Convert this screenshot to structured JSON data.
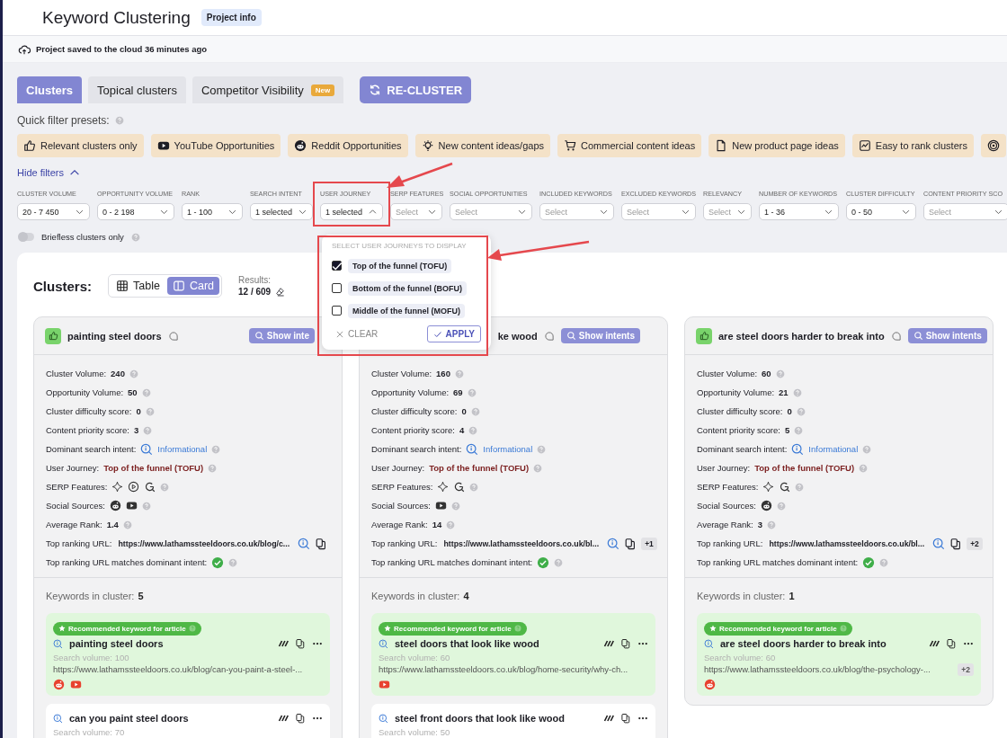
{
  "header": {
    "title": "Keyword Clustering",
    "badge": "Project info"
  },
  "save_status": "Project saved to the cloud 36 minutes ago",
  "tabs": [
    {
      "label": "Clusters",
      "selected": true
    },
    {
      "label": "Topical clusters",
      "selected": false
    },
    {
      "label": "Competitor Visibility",
      "selected": false,
      "badge": "New"
    }
  ],
  "recluster_button": "RE-CLUSTER",
  "presets": {
    "label": "Quick filter presets:",
    "items": [
      {
        "kind": "thumb",
        "label": "Relevant clusters only"
      },
      {
        "kind": "youtube",
        "label": "YouTube Opportunities"
      },
      {
        "kind": "reddit",
        "label": "Reddit Opportunities"
      },
      {
        "kind": "bulb",
        "label": "New content ideas/gaps"
      },
      {
        "kind": "cart",
        "label": "Commercial content ideas"
      },
      {
        "kind": "doc",
        "label": "New product page ideas"
      },
      {
        "kind": "chart",
        "label": "Easy to rank clusters"
      },
      {
        "kind": "target"
      }
    ]
  },
  "hide_filters": {
    "label": "Hide filters",
    "expanded": true
  },
  "filters": [
    {
      "label": "CLUSTER VOLUME",
      "value": "20 - 7 450"
    },
    {
      "label": "OPPORTUNITY VOLUME",
      "value": "0 - 2 198"
    },
    {
      "label": "RANK",
      "value": "1 - 100"
    },
    {
      "label": "SEARCH INTENT",
      "value": "1 selected"
    },
    {
      "label": "USER JOURNEY",
      "value": "1 selected",
      "expanded": true,
      "highlighted": true,
      "dropdown": {
        "heading": "SELECT USER JOURNEYS TO DISPLAY",
        "options": [
          {
            "label": "Top of the funnel (TOFU)",
            "checked": true
          },
          {
            "label": "Bottom of the funnel (BOFU)",
            "checked": false
          },
          {
            "label": "Middle of the funnel (MOFU)",
            "checked": false
          }
        ],
        "clear": "CLEAR",
        "apply": "APPLY"
      }
    },
    {
      "label": "SERP FEATURES",
      "placeholder": "Select"
    },
    {
      "label": "SOCIAL OPPORTUNITIES",
      "placeholder": "Select"
    },
    {
      "label": "INCLUDED KEYWORDS",
      "placeholder": "Select"
    },
    {
      "label": "EXCLUDED KEYWORDS",
      "placeholder": "Select"
    },
    {
      "label": "RELEVANCY",
      "placeholder": "Select"
    },
    {
      "label": "NUMBER OF KEYWORDS",
      "value": "1 - 36"
    },
    {
      "label": "CLUSTER DIFFICULTY",
      "value": "0 - 50"
    },
    {
      "label": "CONTENT PRIORITY SCO",
      "placeholder": "Select"
    }
  ],
  "briefless_toggle": {
    "label": "Briefless clusters only",
    "on": false
  },
  "clusters": {
    "title": "Clusters:",
    "views": [
      {
        "kind": "table",
        "label": "Table",
        "selected": false
      },
      {
        "kind": "card",
        "label": "Card",
        "selected": true
      }
    ],
    "results_label": "Results:",
    "results_value": "12 / 609",
    "cards": [
      {
        "thumb": true,
        "title": "painting steel doors",
        "intents_button": "Show inte",
        "stats": [
          {
            "kind": "value",
            "label": "Cluster Volume:",
            "value": "240"
          },
          {
            "kind": "value",
            "label": "Opportunity Volume:",
            "value": "50"
          },
          {
            "kind": "value",
            "label": "Cluster difficulty score:",
            "value": "0"
          },
          {
            "kind": "value",
            "label": "Content priority score:",
            "value": "3"
          },
          {
            "kind": "intent",
            "label": "Dominant search intent:",
            "value": "Informational"
          },
          {
            "kind": "journey",
            "label": "User Journey:",
            "value": "Top of the funnel (TOFU)"
          },
          {
            "kind": "icons",
            "label": "SERP Features:",
            "icons": [
              {
                "kind": "sparkle"
              },
              {
                "kind": "play"
              },
              {
                "kind": "google"
              }
            ]
          },
          {
            "kind": "icons",
            "label": "Social Sources:",
            "icons": [
              {
                "kind": "reddit"
              },
              {
                "kind": "youtube"
              }
            ]
          },
          {
            "kind": "value",
            "label": "Average Rank:",
            "value": "1.4"
          },
          {
            "kind": "url",
            "label": "Top ranking URL:",
            "value": "https://www.lathamssteeldoors.co.uk/blog/c..."
          },
          {
            "kind": "match",
            "label": "Top ranking URL matches dominant intent:",
            "ok": true
          }
        ],
        "keywords_label": "Keywords in cluster:",
        "keywords_count": "5",
        "keywords": [
          {
            "recommended": true,
            "badge": "Recommended keyword for article",
            "title": "painting steel doors",
            "volume": "Search volume: 100",
            "url": "https://www.lathamssteeldoors.co.uk/blog/can-you-paint-a-steel-...",
            "icons": [
              {
                "kind": "reddit"
              },
              {
                "kind": "youtube"
              }
            ]
          },
          {
            "recommended": false,
            "title": "can you paint steel doors",
            "volume": "Search volume: 70"
          }
        ]
      },
      {
        "thumb": false,
        "title": "ke wood",
        "intents_button": "Show intents",
        "stats": [
          {
            "kind": "value",
            "label": "Cluster Volume:",
            "value": "160"
          },
          {
            "kind": "value",
            "label": "Opportunity Volume:",
            "value": "69"
          },
          {
            "kind": "value",
            "label": "Cluster difficulty score:",
            "value": "0"
          },
          {
            "kind": "value",
            "label": "Content priority score:",
            "value": "4"
          },
          {
            "kind": "intent",
            "label": "Dominant search intent:",
            "value": "Informational"
          },
          {
            "kind": "journey",
            "label": "User Journey:",
            "value": "Top of the funnel (TOFU)"
          },
          {
            "kind": "icons",
            "label": "SERP Features:",
            "icons": [
              {
                "kind": "sparkle"
              },
              {
                "kind": "google"
              }
            ]
          },
          {
            "kind": "icons",
            "label": "Social Sources:",
            "icons": [
              {
                "kind": "youtube"
              }
            ]
          },
          {
            "kind": "value",
            "label": "Average Rank:",
            "value": "14"
          },
          {
            "kind": "url",
            "label": "Top ranking URL:",
            "value": "https://www.lathamssteeldoors.co.uk/bl...",
            "extra": "+1"
          },
          {
            "kind": "match",
            "label": "Top ranking URL matches dominant intent:",
            "ok": true
          }
        ],
        "keywords_label": "Keywords in cluster:",
        "keywords_count": "4",
        "keywords": [
          {
            "recommended": true,
            "badge": "Recommended keyword for article",
            "title": "steel doors that look like wood",
            "volume": "Search volume: 60",
            "url": "https://www.lathamssteeldoors.co.uk/blog/home-security/why-ch...",
            "icons": [
              {
                "kind": "youtube"
              }
            ]
          },
          {
            "recommended": false,
            "title": "steel front doors that look like wood",
            "volume": "Search volume: 50"
          }
        ]
      },
      {
        "thumb": true,
        "title": "are steel doors harder to break into",
        "intents_button": "Show intents",
        "stats": [
          {
            "kind": "value",
            "label": "Cluster Volume:",
            "value": "60"
          },
          {
            "kind": "value",
            "label": "Opportunity Volume:",
            "value": "21"
          },
          {
            "kind": "value",
            "label": "Cluster difficulty score:",
            "value": "0"
          },
          {
            "kind": "value",
            "label": "Content priority score:",
            "value": "5"
          },
          {
            "kind": "intent",
            "label": "Dominant search intent:",
            "value": "Informational"
          },
          {
            "kind": "journey",
            "label": "User Journey:",
            "value": "Top of the funnel (TOFU)"
          },
          {
            "kind": "icons",
            "label": "SERP Features:",
            "icons": [
              {
                "kind": "sparkle"
              },
              {
                "kind": "google"
              }
            ]
          },
          {
            "kind": "icons",
            "label": "Social Sources:",
            "icons": [
              {
                "kind": "reddit"
              }
            ]
          },
          {
            "kind": "value",
            "label": "Average Rank:",
            "value": "3"
          },
          {
            "kind": "url",
            "label": "Top ranking URL:",
            "value": "https://www.lathamssteeldoors.co.uk/bl...",
            "extra": "+2"
          },
          {
            "kind": "match",
            "label": "Top ranking URL matches dominant intent:",
            "ok": true
          }
        ],
        "keywords_label": "Keywords in cluster:",
        "keywords_count": "1",
        "keywords": [
          {
            "recommended": true,
            "badge": "Recommended keyword for article",
            "title": "are steel doors harder to break into",
            "volume": "Search volume: 60",
            "url": "https://www.lathamssteeldoors.co.uk/blog/the-psychology-...",
            "extra": "+2",
            "icons": [
              {
                "kind": "reddit"
              }
            ]
          }
        ]
      }
    ]
  }
}
